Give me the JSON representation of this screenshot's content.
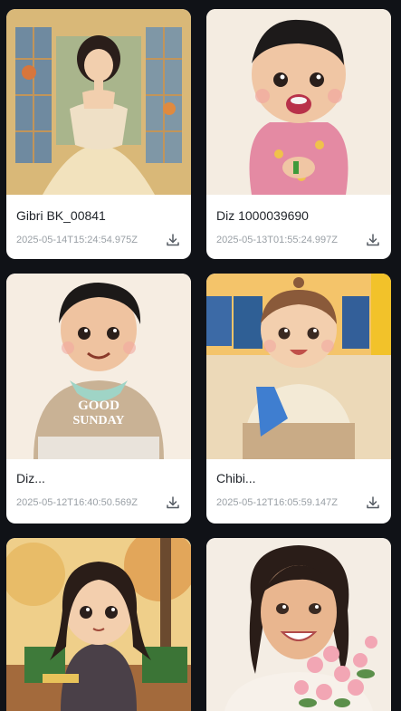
{
  "cards": [
    {
      "title": "Gibri BK_00841",
      "timestamp": "2025-05-14T15:24:54.975Z",
      "image": "ghibli-girl-ballgown-portrait",
      "icon": "download-icon"
    },
    {
      "title": "Diz 1000039690",
      "timestamp": "2025-05-13T01:55:24.997Z",
      "image": "cartoon-baby-pink-sweater",
      "icon": "download-icon"
    },
    {
      "title": "Diz...",
      "timestamp": "2025-05-12T16:40:50.569Z",
      "image": "cartoon-boy-good-sunday-sweater",
      "icon": "download-icon"
    },
    {
      "title": "Chibi...",
      "timestamp": "2025-05-12T16:05:59.147Z",
      "image": "chibi-toddler-blue-toy",
      "icon": "download-icon"
    },
    {
      "title": "",
      "timestamp": "",
      "image": "chibi-girl-autumn-park",
      "icon": ""
    },
    {
      "title": "",
      "timestamp": "",
      "image": "cartoon-woman-flowers",
      "icon": ""
    }
  ],
  "image_text": {
    "sweater_text": "GOOD SUNDAY"
  },
  "colors": {
    "background": "#101217",
    "card": "#ffffff",
    "title": "#1f2329",
    "meta": "#9aa0a6"
  }
}
